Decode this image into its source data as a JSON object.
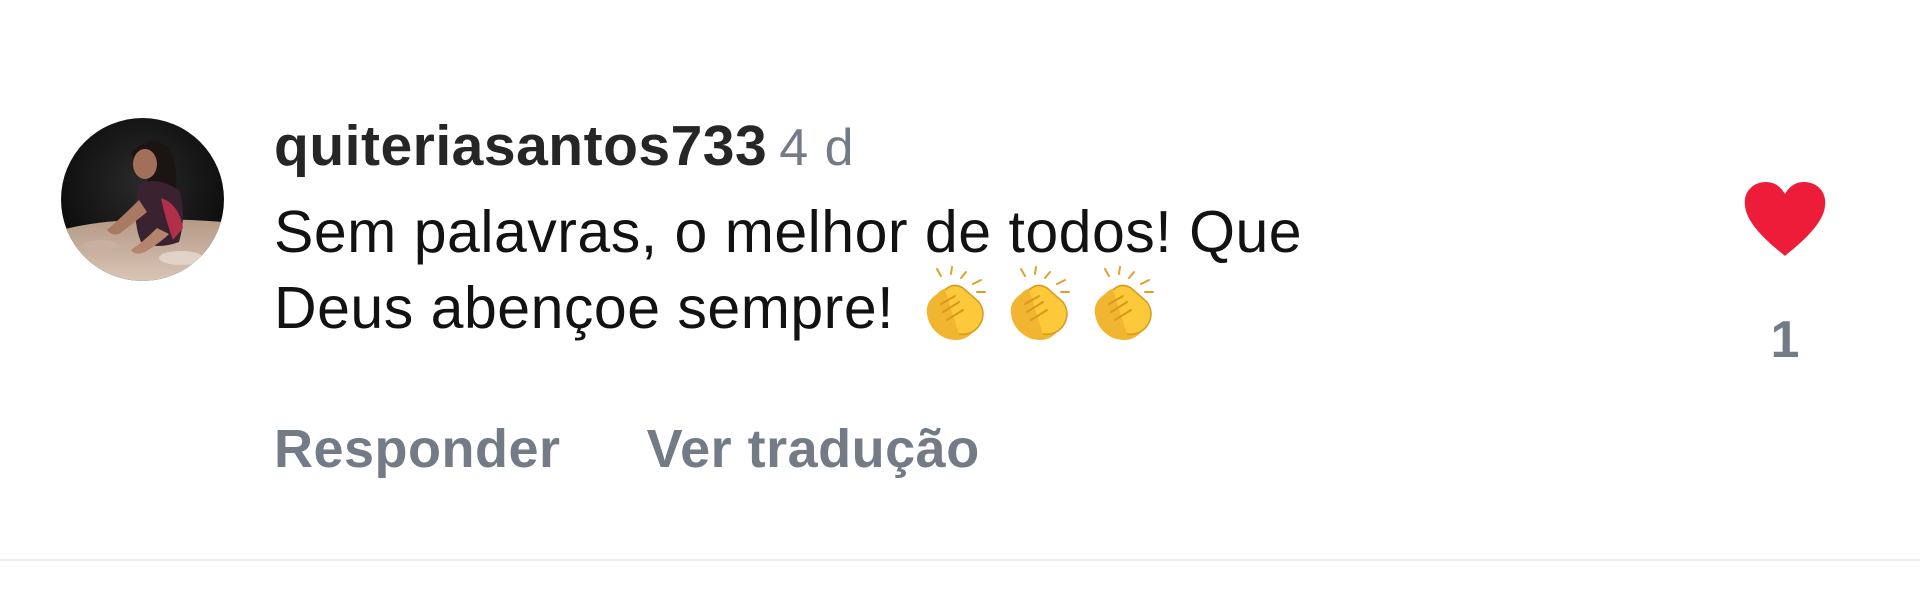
{
  "comment": {
    "avatar_icon": "user-avatar-photo",
    "username": "quiteriasantos733",
    "timestamp": "4 d",
    "text_lines": [
      "Sem palavras, o melhor de todos! Que",
      "Deus abençoe sempre!"
    ],
    "emoji": [
      "👏",
      "👏",
      "👏"
    ],
    "emoji_icon": "clapping-hands-icon",
    "actions": {
      "reply_label": "Responder",
      "translate_label": "Ver tradução"
    },
    "like": {
      "icon": "heart-icon",
      "liked": true,
      "color": "#ed1d39",
      "count": "1"
    }
  },
  "colors": {
    "primary_text": "#121212",
    "secondary_text": "#737b86",
    "divider": "#ececec"
  }
}
